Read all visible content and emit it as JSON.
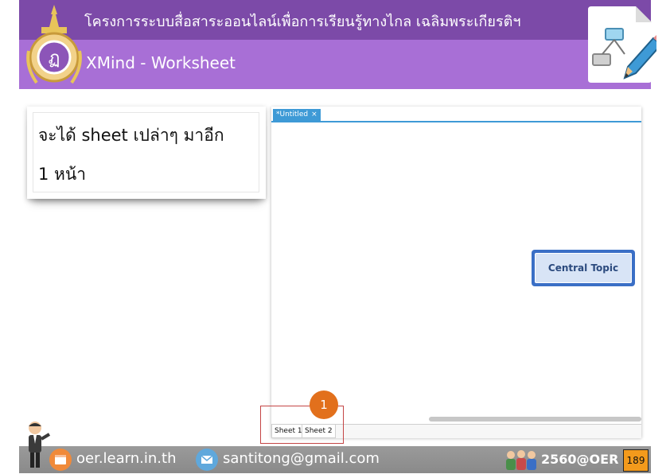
{
  "header": {
    "title": "โครงการระบบสื่อสาระออนไลน์เพื่อการเรียนรู้ทางไกล เฉลิมพระเกียรติฯ",
    "subtitle": "XMind - Worksheet"
  },
  "callout": {
    "line1": "จะได้ sheet เปล่าๆ มาอีก",
    "line2": "1 หน้า"
  },
  "app": {
    "tab_label": "*Untitled",
    "tab_close": "×",
    "central_topic": "Central Topic",
    "sheet_tabs": [
      "Sheet 1",
      "Sheet 2"
    ]
  },
  "step_badge": "1",
  "footer": {
    "website": "oer.learn.in.th",
    "email": "santitong@gmail.com",
    "program": "2560@OER",
    "page_number": "189"
  },
  "colors": {
    "header_dark": "#7c4aa8",
    "header_light": "#a86fd6",
    "tab_blue": "#3e9ad6",
    "topic_border": "#3a6fc6",
    "badge_orange": "#e2701c",
    "page_badge": "#f39a1c"
  },
  "icons": [
    "emblem-icon",
    "mindmap-document-icon",
    "pencil-icon",
    "teacher-mascot-icon",
    "browser-icon",
    "mail-icon",
    "students-icon"
  ]
}
